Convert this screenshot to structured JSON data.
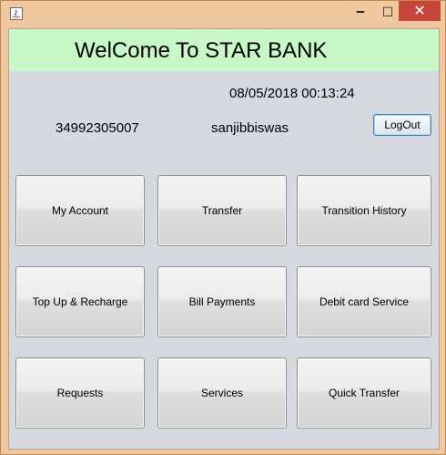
{
  "window": {
    "minimize_glyph": "🗕",
    "maximize_glyph": "☐",
    "close_glyph": "✕"
  },
  "header": {
    "title": "WelCome To STAR BANK"
  },
  "session": {
    "datetime": "08/05/2018 00:13:24",
    "account_number": "34992305007",
    "username": "sanjibbiswas",
    "logout_label": "LogOut"
  },
  "menu": {
    "my_account": "My Account",
    "transfer": "Transfer",
    "transaction_history": "Transition History",
    "top_up": "Top Up & Recharge",
    "bill_payments": "Bill Payments",
    "debit_card": "Debit card Service",
    "requests": "Requests",
    "services": "Services",
    "quick_transfer": "Quick Transfer"
  },
  "colors": {
    "banner_bg": "#c8f8c8",
    "panel_bg": "#d6d9e0",
    "close_button": "#c7453a",
    "titlebar": "#f0c8a0"
  }
}
